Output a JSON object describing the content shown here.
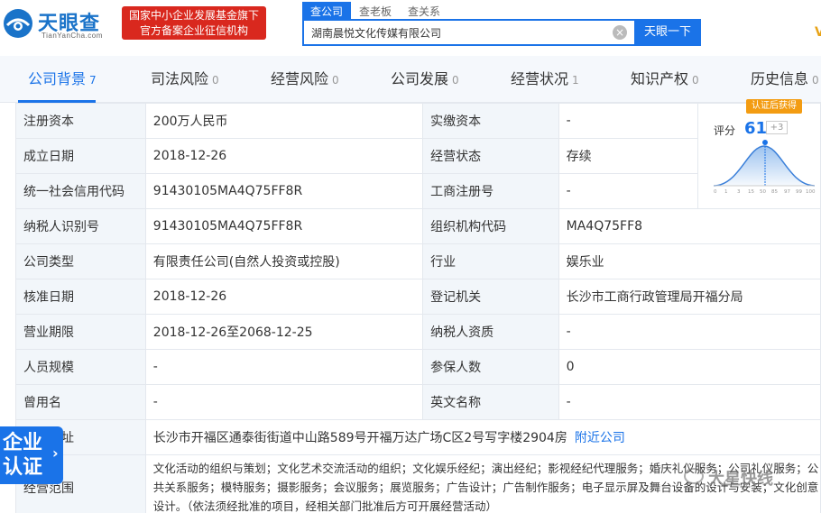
{
  "brand": {
    "name": "天眼查",
    "domain": "TianYanCha.com"
  },
  "badge": {
    "line1": "国家中小企业发展基金旗下",
    "line2": "官方备案企业征信机构"
  },
  "search": {
    "tabs": [
      {
        "label": "查公司",
        "active": true
      },
      {
        "label": "查老板",
        "active": false
      },
      {
        "label": "查关系",
        "active": false
      }
    ],
    "value": "湖南晨悦文化传媒有限公司",
    "button": "天眼一下"
  },
  "nav": [
    {
      "label": "公司背景",
      "count": "7",
      "active": true
    },
    {
      "label": "司法风险",
      "count": "0",
      "active": false
    },
    {
      "label": "经营风险",
      "count": "0",
      "active": false
    },
    {
      "label": "公司发展",
      "count": "0",
      "active": false
    },
    {
      "label": "经营状况",
      "count": "1",
      "active": false
    },
    {
      "label": "知识产权",
      "count": "0",
      "active": false
    },
    {
      "label": "历史信息",
      "count": "0",
      "active": false
    }
  ],
  "info": {
    "reg_capital_label": "注册资本",
    "reg_capital": "200万人民币",
    "paid_capital_label": "实缴资本",
    "paid_capital": "-",
    "est_date_label": "成立日期",
    "est_date": "2018-12-26",
    "status_label": "经营状态",
    "status": "存续",
    "credit_code_label": "统一社会信用代码",
    "credit_code": "91430105MA4Q75FF8R",
    "reg_no_label": "工商注册号",
    "reg_no": "-",
    "tax_id_label": "纳税人识别号",
    "tax_id": "91430105MA4Q75FF8R",
    "org_code_label": "组织机构代码",
    "org_code": "MA4Q75FF8",
    "type_label": "公司类型",
    "type": "有限责任公司(自然人投资或控股)",
    "industry_label": "行业",
    "industry": "娱乐业",
    "approve_date_label": "核准日期",
    "approve_date": "2018-12-26",
    "authority_label": "登记机关",
    "authority": "长沙市工商行政管理局开福分局",
    "term_label": "营业期限",
    "term": "2018-12-26至2068-12-25",
    "taxpayer_label": "纳税人资质",
    "taxpayer": "-",
    "staff_label": "人员规模",
    "staff": "-",
    "insured_label": "参保人数",
    "insured": "0",
    "former_label": "曾用名",
    "former": "-",
    "en_name_label": "英文名称",
    "en_name": "-",
    "address_label": "注册地址",
    "address": "长沙市开福区通泰街街道中山路589号开福万达广场C区2号写字楼2904房",
    "nearby": "附近公司",
    "scope_label": "经营范围",
    "scope": "文化活动的组织与策划；文化艺术交流活动的组织；文化娱乐经纪；演出经纪；影视经纪代理服务；婚庆礼仪服务；公司礼仪服务；公共关系服务；模特服务；摄影服务；会议服务；展览服务；广告设计；广告制作服务；电子显示屏及舞台设备的设计与安装；文化创意设计。（依法须经批准的项目，经相关部门批准后方可开展经营活动）"
  },
  "score": {
    "cert": "认证后获得",
    "label": "评分",
    "value": "61",
    "delta": "+3",
    "ticks": [
      "0",
      "1",
      "3",
      "15",
      "50",
      "85",
      "97",
      "99",
      "100"
    ]
  },
  "floattag": {
    "text": "企业认证"
  },
  "watermark": "大星快线",
  "colors": {
    "primary": "#1a73e8",
    "badge": "#d9281e",
    "cert": "#f39c12"
  }
}
